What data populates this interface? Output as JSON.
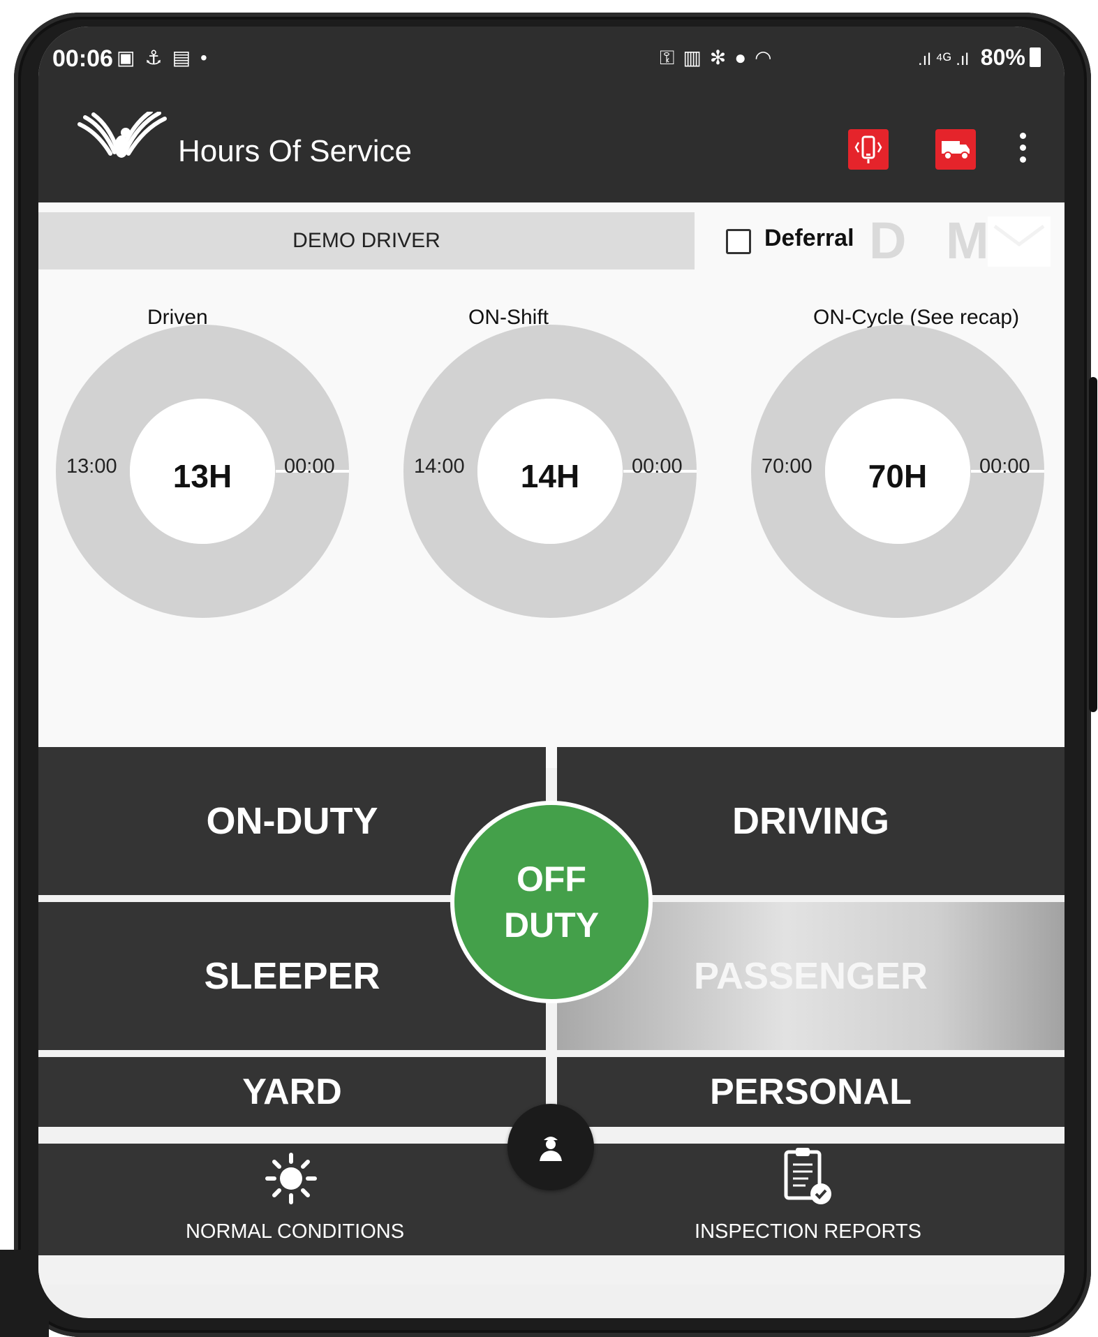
{
  "status_bar": {
    "time": "00:06",
    "left_icons": [
      "gallery-icon",
      "usb-icon",
      "app-icon",
      "dot-icon"
    ],
    "mid_icons": [
      "key-icon",
      "lock-icon",
      "bluetooth-icon",
      "location-icon",
      "wifi-icon"
    ],
    "signal": ".ıl ⁴ᴳ .ıl",
    "battery_text": "80%"
  },
  "app_bar": {
    "title": "Hours Of Service",
    "buttons": [
      "eld-connection-icon",
      "truck-icon"
    ],
    "accent_color": "#e5242b"
  },
  "driver": {
    "name": "DEMO DRIVER",
    "deferral_label": "Deferral",
    "deferral_checked": false,
    "dm_letters": "D M"
  },
  "gauges": [
    {
      "title": "Driven",
      "left": "13:00",
      "center": "13H",
      "right": "00:00"
    },
    {
      "title": "ON-Shift",
      "left": "14:00",
      "center": "14H",
      "right": "00:00"
    },
    {
      "title": "ON-Cycle (See recap)",
      "left": "70:00",
      "center": "70H",
      "right": "00:00"
    }
  ],
  "duty_status": {
    "on_duty": "ON-DUTY",
    "driving": "DRIVING",
    "sleeper": "SLEEPER",
    "passenger": "PASSENGER",
    "yard": "YARD",
    "personal": "PERSONAL",
    "off_duty_line1": "OFF",
    "off_duty_line2": "DUTY",
    "off_duty_color": "#44a04a"
  },
  "bottom_nav": {
    "left_label": "NORMAL CONDITIONS",
    "left_icon": "sun-icon",
    "right_label": "INSPECTION REPORTS",
    "right_icon": "clipboard-check-icon",
    "fab_icon": "driver-icon"
  }
}
